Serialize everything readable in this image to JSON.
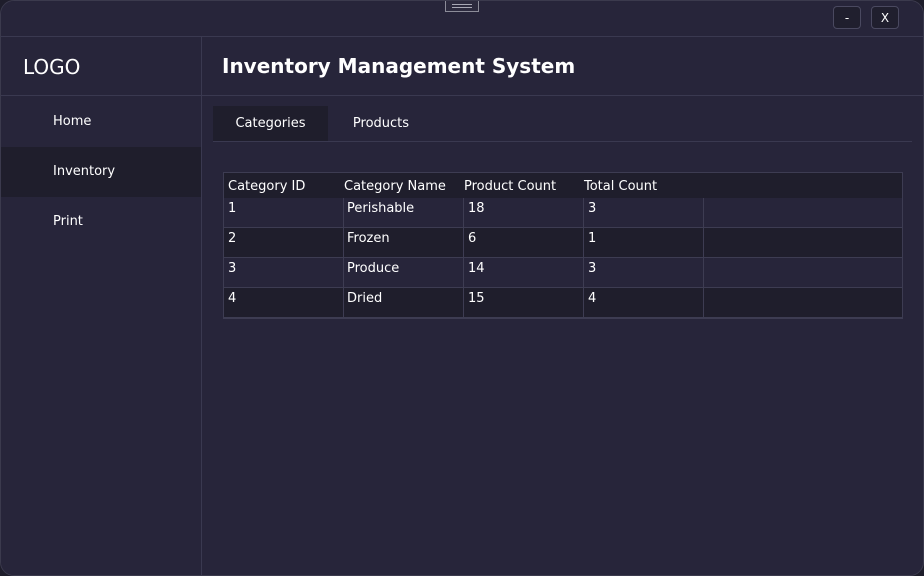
{
  "window": {
    "minimize_label": "-",
    "close_label": "X"
  },
  "sidebar": {
    "logo": "LOGO",
    "items": [
      {
        "label": "Home",
        "active": false
      },
      {
        "label": "Inventory",
        "active": true
      },
      {
        "label": "Print",
        "active": false
      }
    ]
  },
  "header": {
    "title": "Inventory Management System"
  },
  "tabs": [
    {
      "label": "Categories",
      "selected": true
    },
    {
      "label": "Products",
      "selected": false
    }
  ],
  "table": {
    "columns": [
      "Category ID",
      "Category Name",
      "Product Count",
      "Total Count"
    ],
    "rows": [
      [
        "1",
        "Perishable",
        "18",
        "3"
      ],
      [
        "2",
        "Frozen",
        "6",
        "1"
      ],
      [
        "3",
        "Produce",
        "14",
        "3"
      ],
      [
        "4",
        "Dried",
        "15",
        "4"
      ]
    ]
  },
  "colors": {
    "window_bg": "#27253a",
    "selected_bg": "#1f1e2c",
    "border": "#3a3950"
  }
}
